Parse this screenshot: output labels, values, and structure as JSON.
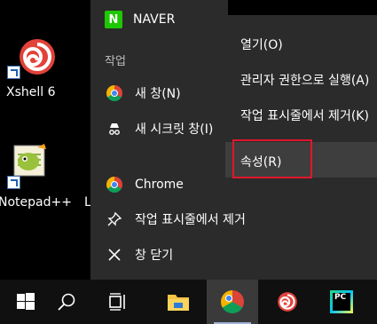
{
  "desktop": {
    "icons": [
      {
        "label": "Xshell 6"
      },
      {
        "label": "Notepad++"
      },
      {
        "label": "L"
      }
    ]
  },
  "jumplist": {
    "top_app": "NAVER",
    "section_label": "작업",
    "tasks": [
      {
        "label": "새 창(N)"
      },
      {
        "label": "새 시크릿 창(I)"
      }
    ],
    "app_name": "Chrome",
    "unpin_label": "작업 표시줄에서 제거",
    "close_label": "창 닫기"
  },
  "context_menu": {
    "items": [
      {
        "label": "열기(O)"
      },
      {
        "label": "관리자 권한으로 실행(A)"
      },
      {
        "label": "작업 표시줄에서 제거(K)"
      },
      {
        "label": "속성(R)"
      }
    ],
    "highlight_color": "#e0162b"
  },
  "taskbar": {
    "items": [
      {
        "icon": "windows-start-icon"
      },
      {
        "icon": "search-icon"
      },
      {
        "icon": "task-view-icon"
      },
      {
        "icon": "file-explorer-icon"
      },
      {
        "icon": "chrome-icon"
      },
      {
        "icon": "xshell-icon"
      },
      {
        "icon": "pycharm-icon",
        "label": "PC"
      }
    ]
  }
}
